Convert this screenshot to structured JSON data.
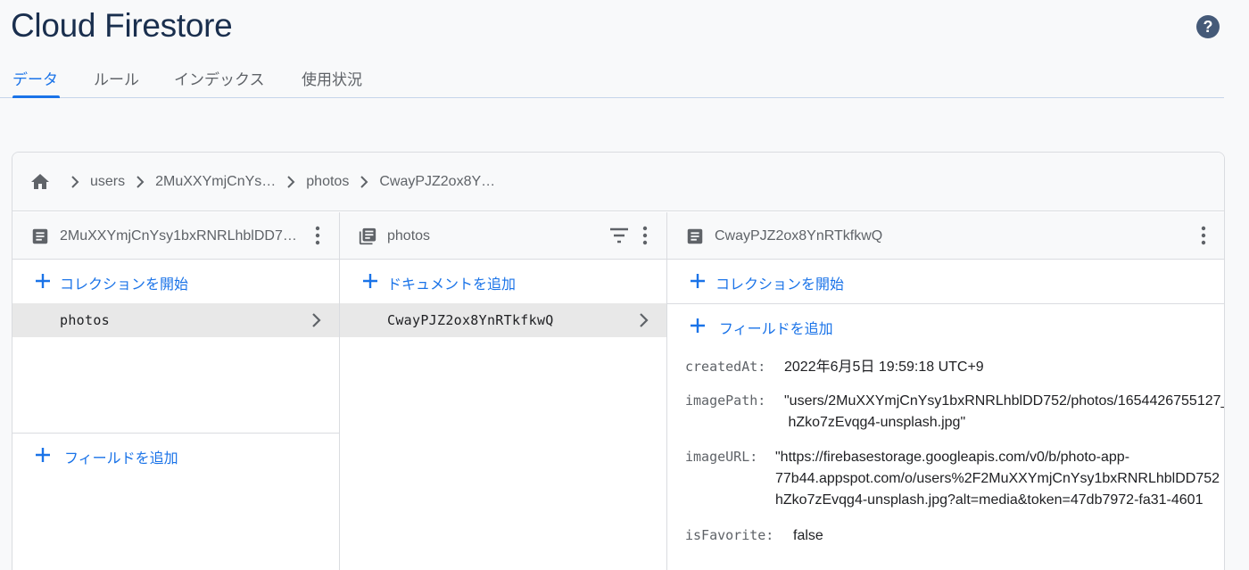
{
  "header": {
    "title": "Cloud Firestore"
  },
  "tabs": [
    {
      "label": "データ"
    },
    {
      "label": "ルール"
    },
    {
      "label": "インデックス"
    },
    {
      "label": "使用状況"
    }
  ],
  "breadcrumb": [
    "users",
    "2MuXXYmjCnYs…",
    "photos",
    "CwayPJZ2ox8Y…"
  ],
  "col1": {
    "title": "2MuXXYmjCnYsy1bxRNRLhblDD7…",
    "start_collection": "コレクションを開始",
    "items": [
      "photos"
    ],
    "add_field": "フィールドを追加"
  },
  "col2": {
    "title": "photos",
    "add_document": "ドキュメントを追加",
    "items": [
      "CwayPJZ2ox8YnRTkfkwQ"
    ]
  },
  "col3": {
    "title": "CwayPJZ2ox8YnRTkfkwQ",
    "start_collection": "コレクションを開始",
    "add_field": "フィールドを追加",
    "fields": [
      {
        "key": "createdAt:",
        "value": "2022年6月5日 19:59:18 UTC+9"
      },
      {
        "key": "imagePath:",
        "value": "\"users/2MuXXYmjCnYsy1bxRNRLhblDD752/photos/1654426755127_\n hZko7zEvqg4-unsplash.jpg\""
      },
      {
        "key": "imageURL:",
        "value": "\"https://firebasestorage.googleapis.com/v0/b/photo-app-\n77b44.appspot.com/o/users%2F2MuXXYmjCnYsy1bxRNRLhblDD752\nhZko7zEvqg4-unsplash.jpg?alt=media&token=47db7972-fa31-4601"
      },
      {
        "key": "isFavorite:",
        "value": "false"
      }
    ]
  },
  "colors": {
    "accent": "#1a73e8",
    "title": "#1a2f4e",
    "selected_row": "#e8e8e8"
  }
}
